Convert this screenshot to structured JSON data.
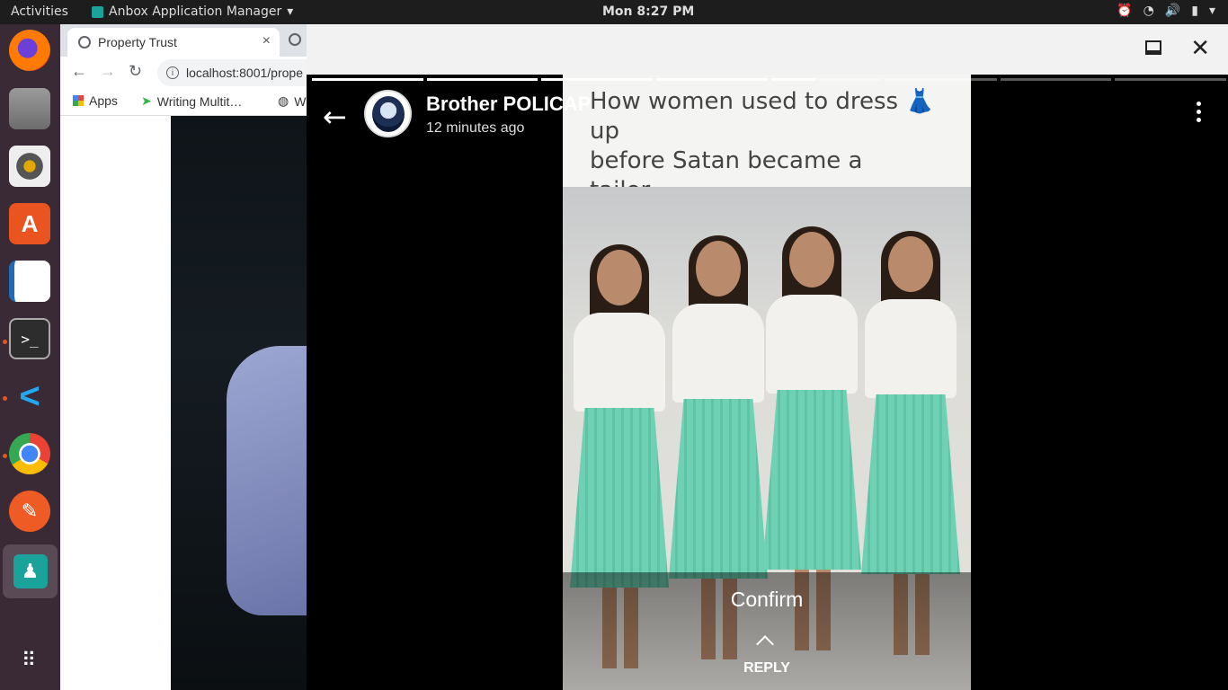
{
  "topbar": {
    "activities": "Activities",
    "app_name": "Anbox Application Manager",
    "clock": "Mon  8:27 PM"
  },
  "dock": {
    "items": [
      "firefox-icon",
      "files-icon",
      "rhythmbox-icon",
      "software-icon",
      "writer-icon",
      "terminal-icon",
      "vscode-icon",
      "chrome-icon",
      "postman-icon",
      "anbox-icon",
      "show-apps-icon"
    ]
  },
  "browser": {
    "tab_title": "Property Trust",
    "tab_close": "×",
    "url": "localhost:8001/prope",
    "bookmarks": [
      {
        "label": "Apps"
      },
      {
        "label": "Writing Multit…"
      },
      {
        "label": "W"
      }
    ]
  },
  "status_viewer": {
    "progress": {
      "segments": 8,
      "viewed": 4,
      "current": 5
    },
    "contact_name": "Brother POLICAP",
    "time_ago": "12 minutes ago",
    "caption_line1": "How women used to dress 👗 up",
    "caption_line2": "before Satan became a tailor....",
    "caption_line3": "🚶🚶🚶🚶",
    "confirm_label": "Confirm",
    "reply_label": "REPLY",
    "back_glyph": "←",
    "close_glyph": "✕"
  }
}
